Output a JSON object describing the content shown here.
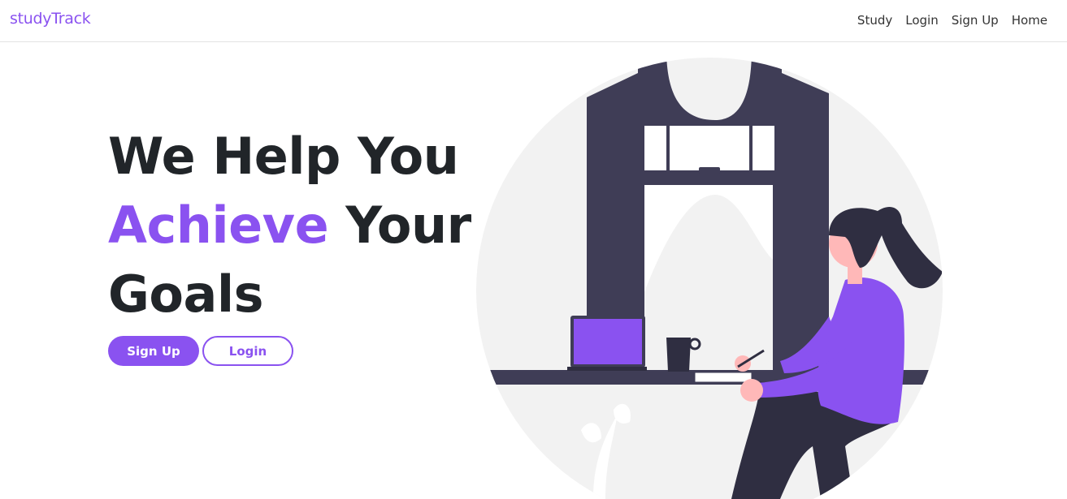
{
  "navbar": {
    "brand": "studyTrack",
    "links": [
      "Study",
      "Login",
      "Sign Up",
      "Home"
    ]
  },
  "hero": {
    "line1": "We Help You",
    "accent_word": "Achieve",
    "line2_rest": " Your",
    "line3": "Goals"
  },
  "buttons": {
    "signup": "Sign Up",
    "login": "Login"
  },
  "colors": {
    "accent": "#8a52f0",
    "dark": "#3f3d56",
    "light_gray": "#f2f2f2",
    "skin": "#ffb8b8"
  },
  "illustration": {
    "icon": "woman-studying-at-window-illustration"
  }
}
